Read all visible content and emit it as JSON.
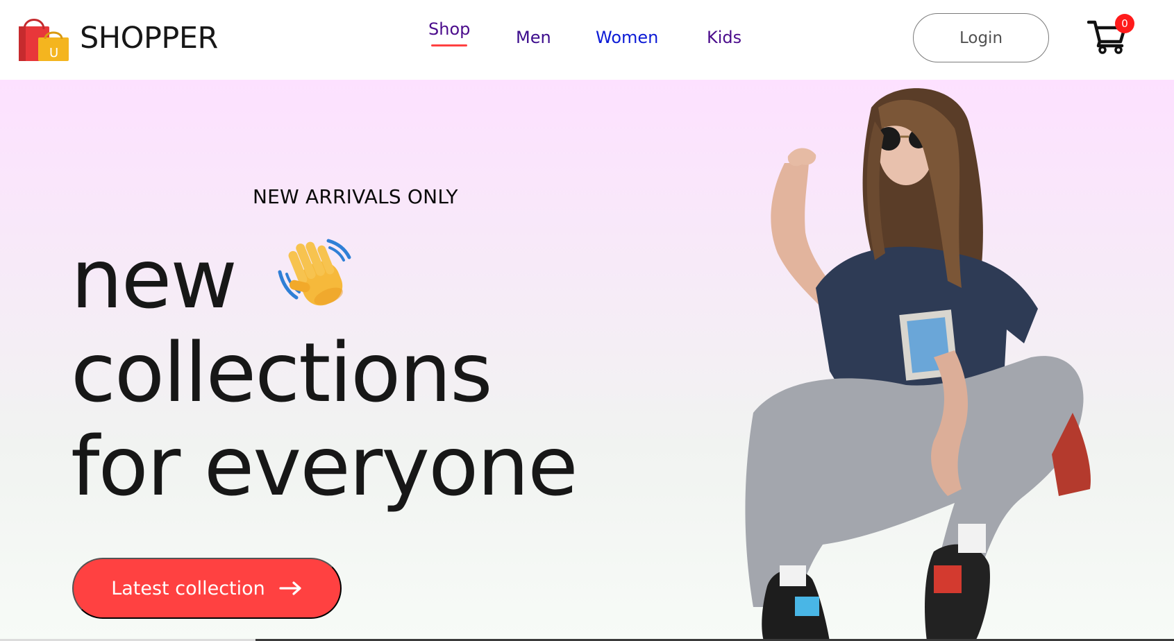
{
  "brand": {
    "name": "SHOPPER",
    "logo_letter": "U"
  },
  "nav": {
    "items": [
      {
        "label": "Shop",
        "active": true
      },
      {
        "label": "Men"
      },
      {
        "label": "Women"
      },
      {
        "label": "Kids"
      }
    ]
  },
  "header": {
    "login_label": "Login",
    "cart_count": "0"
  },
  "hero": {
    "tagline": "NEW ARRIVALS ONLY",
    "line1": "new",
    "line2": "collections",
    "line3": "for everyone",
    "cta_label": "Latest collection",
    "emoji_icon": "waving-hand-icon",
    "cta_icon": "arrow-right-icon"
  },
  "colors": {
    "accent": "#ff4141",
    "hero_gradient_top": "#fde1ff",
    "hero_gradient_bottom": "#f7fbf7",
    "nav_active": "#4b0c8c"
  }
}
